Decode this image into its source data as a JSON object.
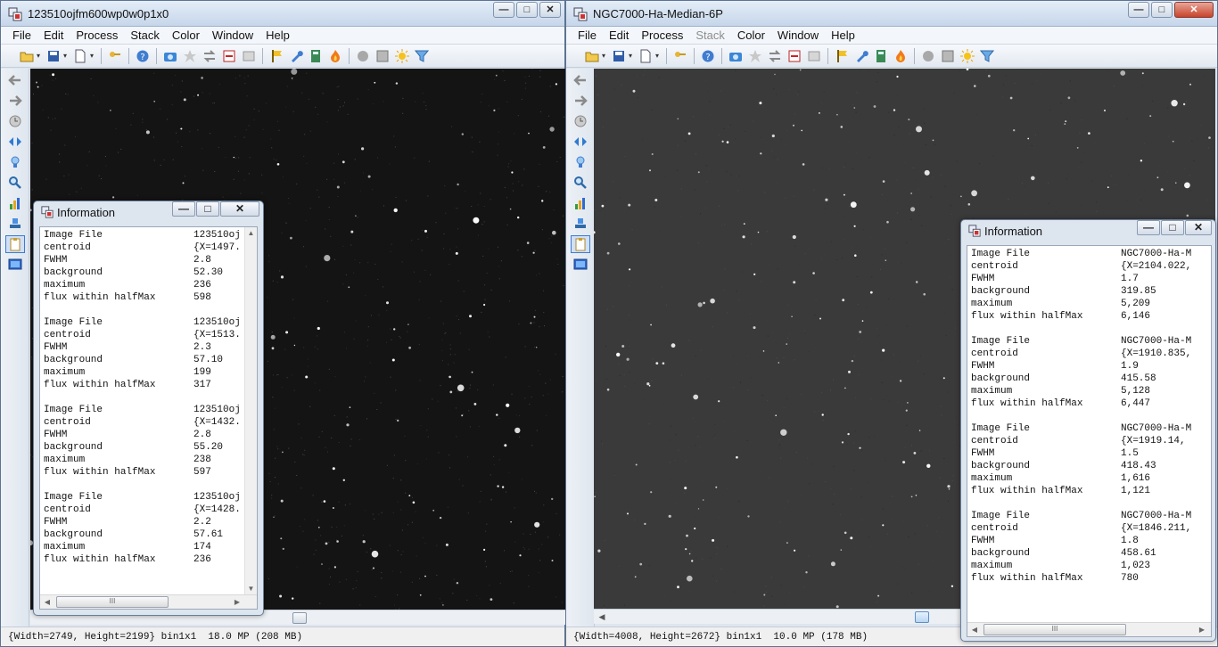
{
  "left_window": {
    "title": "123510ojfm600wp0w0p1x0",
    "menu": [
      "File",
      "Edit",
      "Process",
      "Stack",
      "Color",
      "Window",
      "Help"
    ],
    "status": "{Width=2749, Height=2199} bin1x1  18.0 MP (208 MB)",
    "info_panel": {
      "title": "Information",
      "entries": [
        {
          "image_file": "123510oj",
          "centroid": "{X=1497.",
          "fwhm": "2.8",
          "background": "52.30",
          "maximum": "236",
          "flux": "598"
        },
        {
          "image_file": "123510oj",
          "centroid": "{X=1513.",
          "fwhm": "2.3",
          "background": "57.10",
          "maximum": "199",
          "flux": "317"
        },
        {
          "image_file": "123510oj",
          "centroid": "{X=1432.",
          "fwhm": "2.8",
          "background": "55.20",
          "maximum": "238",
          "flux": "597"
        },
        {
          "image_file": "123510oj",
          "centroid": "{X=1428.",
          "fwhm": "2.2",
          "background": "57.61",
          "maximum": "174",
          "flux": "236"
        }
      ]
    }
  },
  "right_window": {
    "title": "NGC7000-Ha-Median-6P",
    "menu": [
      "File",
      "Edit",
      "Process",
      "Stack",
      "Color",
      "Window",
      "Help"
    ],
    "status": "{Width=4008, Height=2672} bin1x1  10.0 MP (178 MB)",
    "info_panel": {
      "title": "Information",
      "entries": [
        {
          "image_file": "NGC7000-Ha-M",
          "centroid": "{X=2104.022,",
          "fwhm": "1.7",
          "background": "319.85",
          "maximum": "5,209",
          "flux": "6,146"
        },
        {
          "image_file": "NGC7000-Ha-M",
          "centroid": "{X=1910.835,",
          "fwhm": "1.9",
          "background": "415.58",
          "maximum": "5,128",
          "flux": "6,447"
        },
        {
          "image_file": "NGC7000-Ha-M",
          "centroid": "{X=1919.14,",
          "fwhm": "1.5",
          "background": "418.43",
          "maximum": "1,616",
          "flux": "1,121"
        },
        {
          "image_file": "NGC7000-Ha-M",
          "centroid": "{X=1846.211,",
          "fwhm": "1.8",
          "background": "458.61",
          "maximum": "1,023",
          "flux": "780"
        }
      ]
    }
  },
  "field_labels": {
    "image_file": "Image File",
    "centroid": "centroid",
    "fwhm": "FWHM",
    "background": "background",
    "maximum": "maximum",
    "flux": "flux within halfMax"
  },
  "title_buttons": {
    "minimize": "—",
    "maximize": "□",
    "close": "✕"
  },
  "disabled_menu": "Stack",
  "icons": {
    "toolbar": [
      "open-icon",
      "save-icon",
      "new-icon",
      "key-icon",
      "help-icon",
      "camera-icon",
      "star-icon",
      "swap-icon",
      "subtract-icon",
      "align-icon",
      "flag-icon",
      "wrench-icon",
      "calculator-icon",
      "flame-icon",
      "circle-icon",
      "frame-icon",
      "sun-icon",
      "filter-icon"
    ],
    "sidebar": [
      "arrow-left-icon",
      "arrow-right-icon",
      "clock-icon",
      "flip-icon",
      "bulb-icon",
      "zoom-icon",
      "histogram-icon",
      "stamp-icon",
      "clipboard-icon",
      "monitor-icon"
    ]
  },
  "colors": {
    "titlebar": "#c6d6ea",
    "sky_left": "#141414",
    "sky_right": "#3a3a3a",
    "accent": "#3d7bd1"
  }
}
